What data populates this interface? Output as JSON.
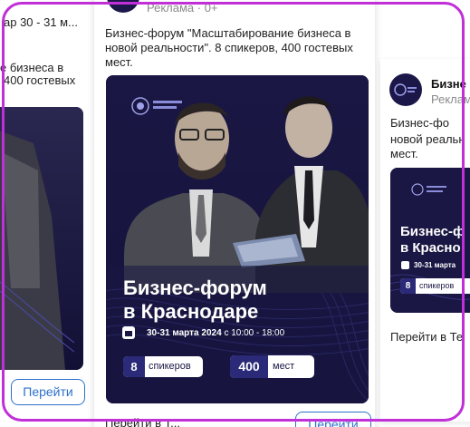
{
  "left_card": {
    "date_fragment": "ар 30 - 31 м...",
    "desc_line1": "е бизнеса в",
    "desc_line2": "400 гостевых",
    "cta": "Перейти"
  },
  "center_card": {
    "badge": "Реклама · 0+",
    "desc_line1": "Бизнес-форум \"Масштабирование бизнеса в",
    "desc_line2": "новой реальности\". 8 спикеров, 400 гостевых",
    "desc_line3": "мест.",
    "banner": {
      "title_line1": "Бизнес-форум",
      "title_line2": "в Краснодаре",
      "date": "30-31 марта 2024",
      "time": "с 10:00 - 18:00",
      "speakers_num": "8",
      "speakers_label": "спикеров",
      "seats_num": "400",
      "seats_label": "мест"
    },
    "footer_text": "Перейти в Т...",
    "cta": "Перейти"
  },
  "right_card": {
    "name": "Бизне",
    "badge": "Реклам",
    "desc_line1": "Бизнес-фо",
    "desc_line2": "новой реальн",
    "desc_line3": "мест.",
    "banner": {
      "title_line1": "Бизнес-ф",
      "title_line2": "в Красно",
      "date": "30-31 марта",
      "speakers_num": "8",
      "speakers_label": "спикеров"
    },
    "footer_text": "Перейти в Те"
  },
  "colors": {
    "frame": "#c12fd8",
    "banner_bg": "#1b1849",
    "accent": "#2d71cc"
  }
}
